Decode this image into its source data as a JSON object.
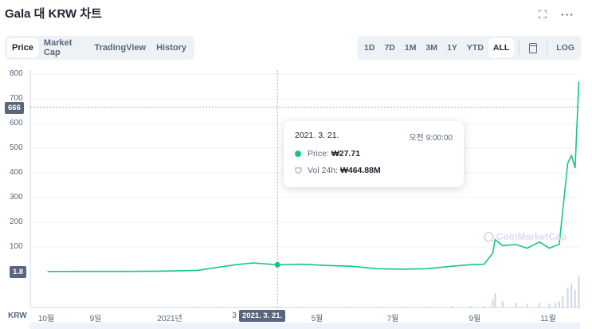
{
  "page": {
    "title": "Gala 대 KRW 차트"
  },
  "header_icons": {
    "expand": "expand-icon",
    "more": "more-icon",
    "expand_glyph": "⛶",
    "more_glyph": "···"
  },
  "view_tabs": [
    {
      "label": "Price",
      "active": true
    },
    {
      "label": "Market Cap",
      "active": false
    },
    {
      "label": "TradingView",
      "active": false
    },
    {
      "label": "History",
      "active": false
    }
  ],
  "range_tabs": [
    {
      "label": "1D",
      "active": false
    },
    {
      "label": "7D",
      "active": false
    },
    {
      "label": "1M",
      "active": false
    },
    {
      "label": "3M",
      "active": false
    },
    {
      "label": "1Y",
      "active": false
    },
    {
      "label": "YTD",
      "active": false
    },
    {
      "label": "ALL",
      "active": true
    }
  ],
  "log_label": "LOG",
  "currency_label": "KRW",
  "crosshair": {
    "price_tag": "666",
    "current_tag": "1.8",
    "date_tag": "2021. 3. 21."
  },
  "tooltip": {
    "date": "2021. 3. 21.",
    "time": "오전 9:00:00",
    "price_label": "Price:",
    "price_value": "₩27.71",
    "vol_label": "Vol 24h:",
    "vol_value": "₩464.88M"
  },
  "watermark": "CoinMarketCap",
  "colors": {
    "line": "#16c784",
    "axis_text": "#58667e",
    "grid": "#eff2f5"
  },
  "chart_data": {
    "type": "line",
    "ylim": [
      0,
      800
    ],
    "yticks": [
      "800",
      "700",
      "600",
      "500",
      "400",
      "300",
      "200",
      "100"
    ],
    "xticks": [
      "10월",
      "9일",
      "2021년",
      "3",
      "5월",
      "7월",
      "9월",
      "11월"
    ],
    "series": [
      {
        "x": [
          "2020-09-15",
          "2020-10-15",
          "2020-11-15",
          "2020-12-15",
          "2021-01-15",
          "2021-02-01",
          "2021-02-15",
          "2021-03-01",
          "2021-03-21",
          "2021-04-10",
          "2021-05-01",
          "2021-05-20",
          "2021-06-10",
          "2021-06-30",
          "2021-07-20",
          "2021-08-10",
          "2021-08-25",
          "2021-09-05",
          "2021-09-12",
          "2021-09-14",
          "2021-09-20",
          "2021-10-01",
          "2021-10-10",
          "2021-10-20",
          "2021-10-28",
          "2021-11-02",
          "2021-11-05",
          "2021-11-08",
          "2021-11-12",
          "2021-11-15",
          "2021-11-18",
          "2021-11-21"
        ],
        "y": [
          0.8,
          0.9,
          1.0,
          2.0,
          5.0,
          18.0,
          28.0,
          35.0,
          27.71,
          30.0,
          25.0,
          22.0,
          12.0,
          10.0,
          12.0,
          22.0,
          28.0,
          30.0,
          75.0,
          130.0,
          105.0,
          110.0,
          95.0,
          120.0,
          95.0,
          105.0,
          110.0,
          250.0,
          440.0,
          470.0,
          420.0,
          770.0
        ]
      }
    ],
    "volume": [
      0,
      0,
      0,
      0,
      1,
      1,
      1,
      1,
      2,
      1,
      1,
      1,
      1,
      1,
      1,
      2,
      2,
      2,
      10,
      18,
      8,
      6,
      5,
      6,
      5,
      6,
      8,
      14,
      25,
      30,
      22,
      40
    ]
  }
}
